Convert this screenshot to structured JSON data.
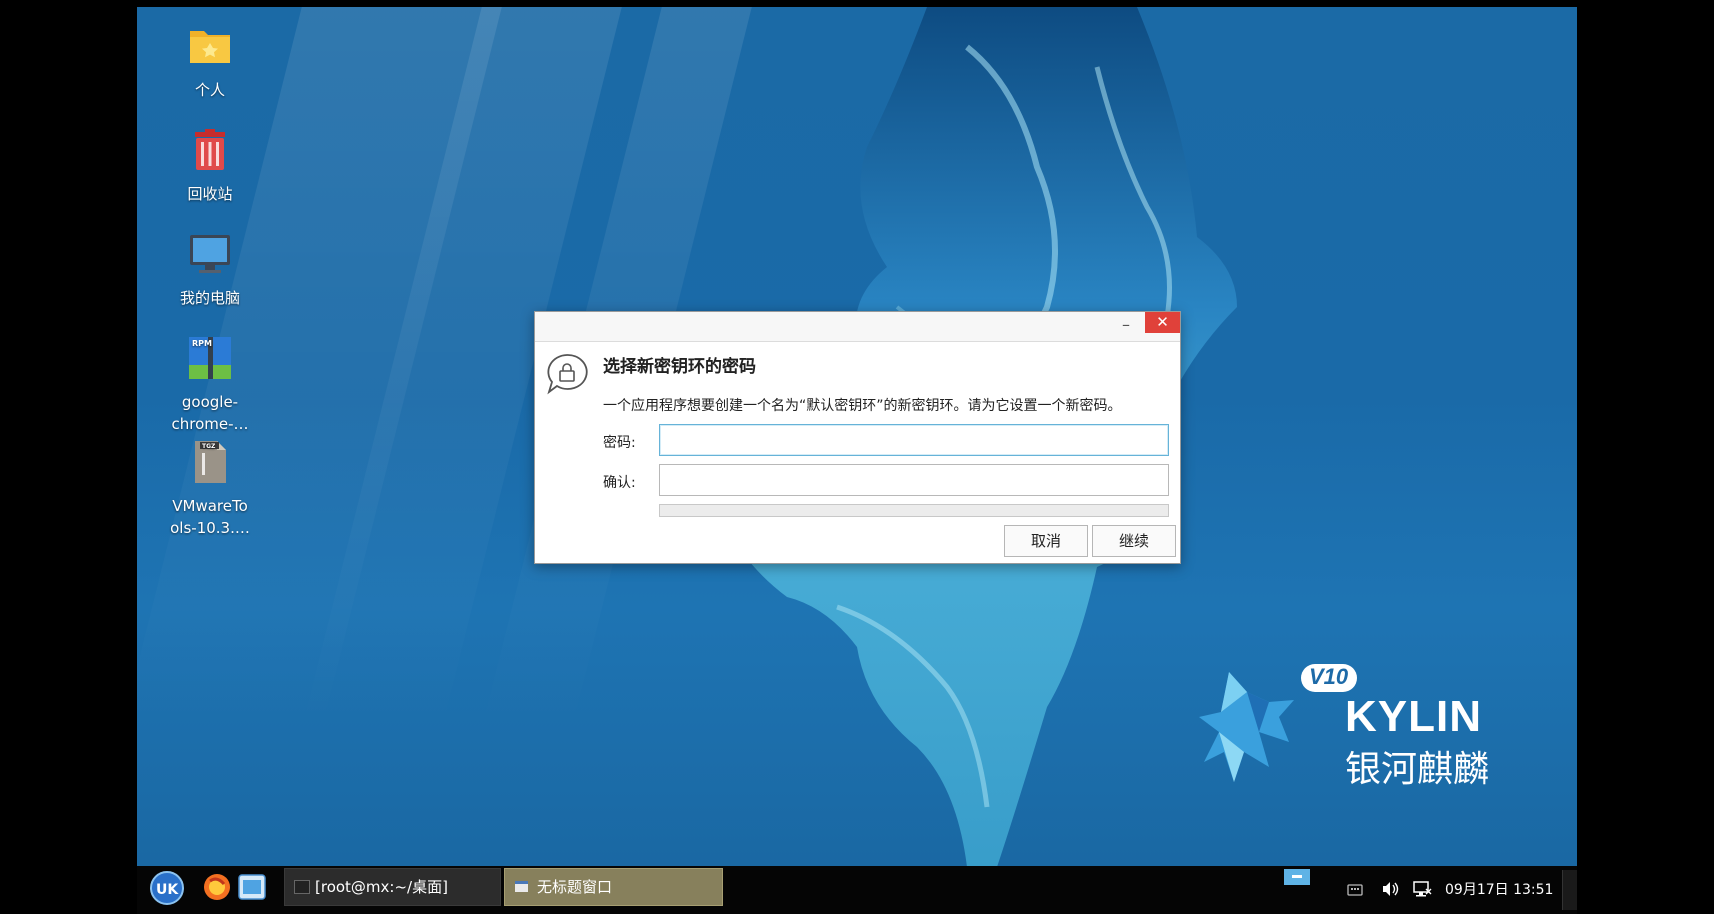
{
  "desktop_icons": [
    {
      "id": "personal",
      "label": "个人"
    },
    {
      "id": "trash",
      "label": "回收站"
    },
    {
      "id": "computer",
      "label": "我的电脑"
    },
    {
      "id": "google",
      "label_line1": "google-",
      "label_line2": "chrome-…"
    },
    {
      "id": "vmware",
      "label_line1": "VMwareTo",
      "label_line2": "ols-10.3.…"
    }
  ],
  "logo": {
    "version": "V10",
    "brand": "KYLIN",
    "chinese": "银河麒麟"
  },
  "dialog": {
    "title": "选择新密钥环的密码",
    "description": "一个应用程序想要创建一个名为“默认密钥环”的新密钥环。请为它设置一个新密码。",
    "password_label": "密码:",
    "confirm_label": "确认:",
    "password_value": "",
    "confirm_value": "",
    "strength": 0,
    "cancel_label": "取消",
    "continue_label": "继续",
    "minimize_symbol": "–",
    "close_symbol": "✕"
  },
  "icon_badges": {
    "rpm": "RPM",
    "tgz": "TGZ",
    "start": "UK"
  },
  "taskbar": {
    "tasks": [
      {
        "label": "[root@mx:~/桌面]"
      },
      {
        "label": "无标题窗口"
      }
    ],
    "clock": "09月17日 13:51"
  },
  "colors": {
    "accent": "#66b3d8",
    "close": "#e0413a",
    "active_task": "#87805c"
  }
}
